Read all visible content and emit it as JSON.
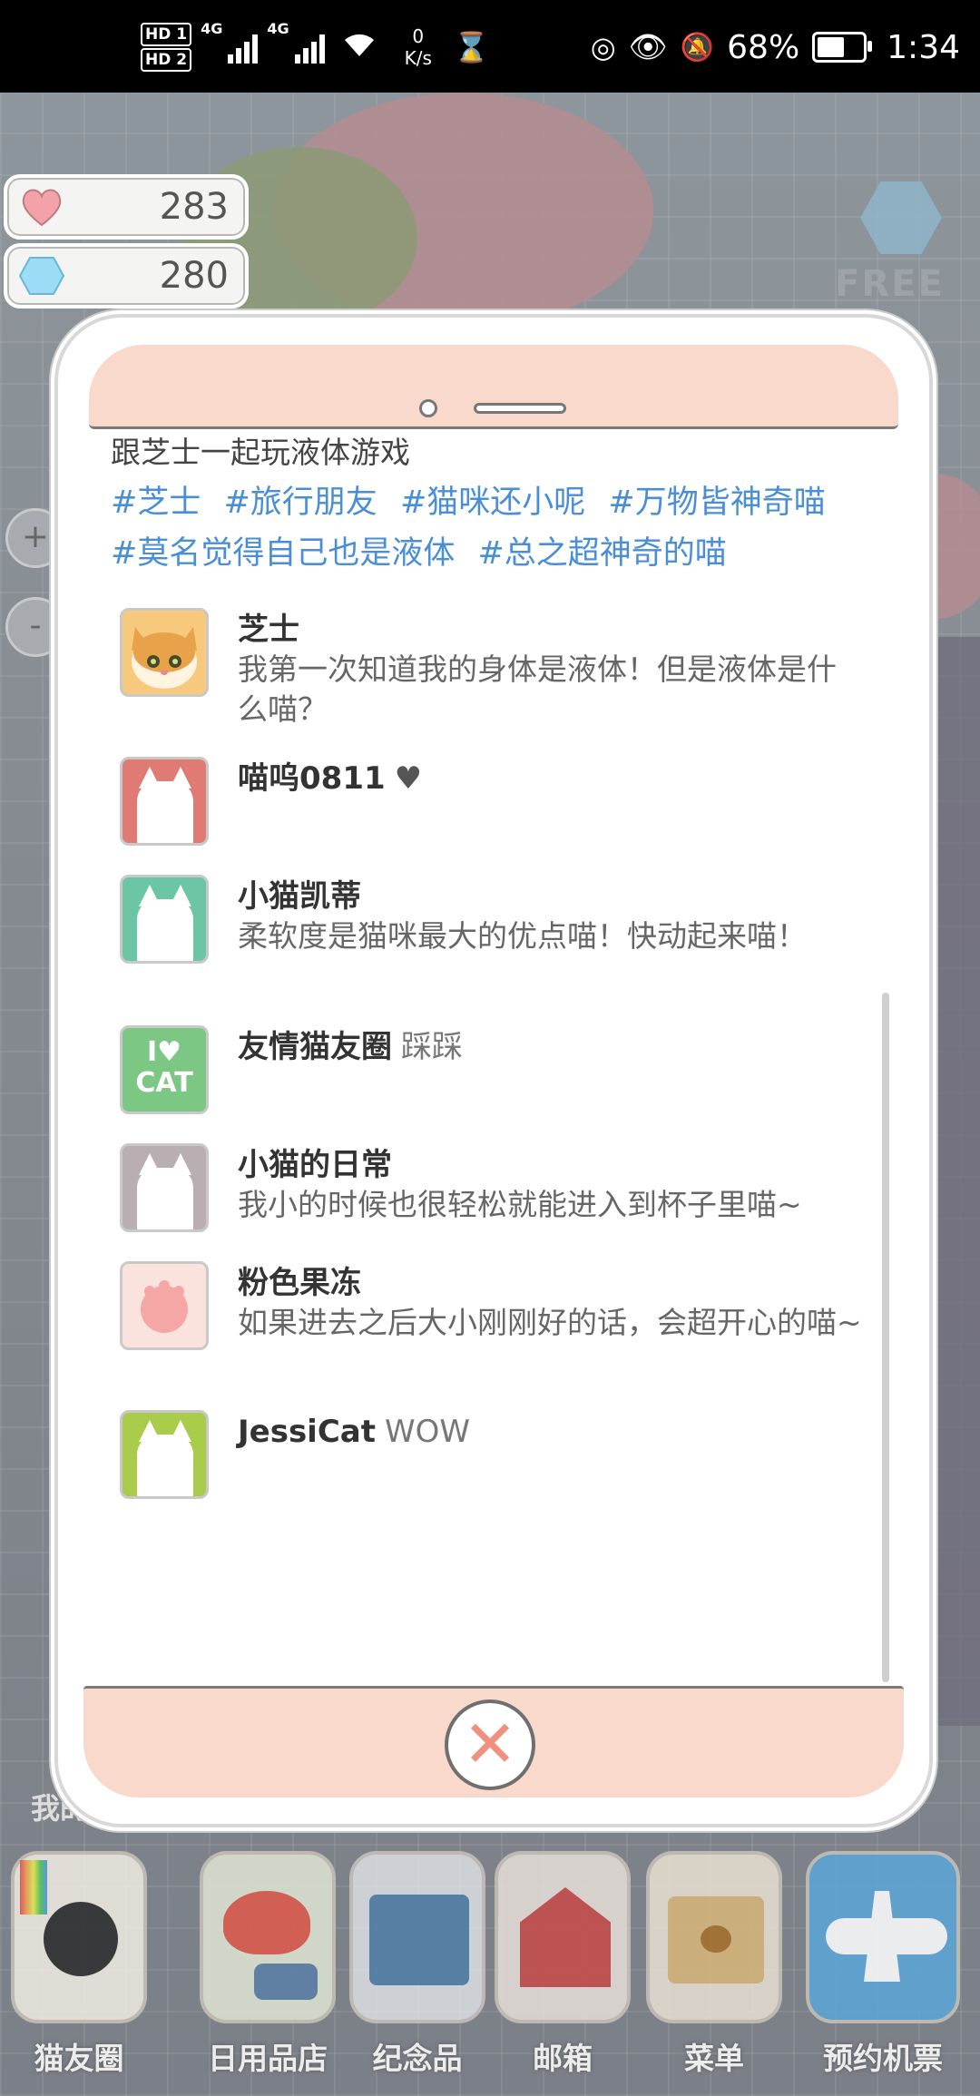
{
  "status_bar": {
    "hd1": "HD 1",
    "hd2": "HD 2",
    "net1": "4G",
    "net2": "4G",
    "speed_value": "0",
    "speed_unit": "K/s",
    "battery": "68%",
    "battery_level": 0.68,
    "time": "1:34"
  },
  "currency": {
    "hearts": "283",
    "gems": "280"
  },
  "free_badge": "FREE",
  "side_buttons": {
    "zoom_in": "+",
    "zoom_out": "-"
  },
  "post": {
    "text": "跟芝士一起玩液体游戏",
    "hashtags": [
      "#芝士",
      "#旅行朋友",
      "#猫咪还小呢",
      "#万物皆神奇喵",
      "#莫名觉得自己也是液体",
      "#总之超神奇的喵"
    ]
  },
  "comments": [
    {
      "name": "芝士",
      "extra": "",
      "text": "我第一次知道我的身体是液体！但是液体是什么喵？",
      "avatar_color": "#f6c97d"
    },
    {
      "name": "喵呜0811",
      "extra": "♥",
      "text": "",
      "avatar_color": "#e07b74"
    },
    {
      "name": "小猫凯蒂",
      "extra": "",
      "text": "柔软度是猫咪最大的优点喵！快动起来喵！",
      "avatar_color": "#6cc6a6"
    },
    {
      "name": "友情猫友圈",
      "extra": "踩踩",
      "text": "",
      "avatar_color": "#7cc784"
    },
    {
      "name": "小猫的日常",
      "extra": "",
      "text": "我小的时候也很轻松就能进入到杯子里喵~",
      "avatar_color": "#b9aeb2"
    },
    {
      "name": "粉色果冻",
      "extra": "",
      "text": "如果进去之后大小刚刚好的话，会超开心的喵~",
      "avatar_color": "#fbe3dd"
    },
    {
      "name": "JessiCat",
      "extra": "WOW",
      "text": "",
      "avatar_color": "#a9cc4a"
    }
  ],
  "avatar_badge": {
    "line1": "I",
    "line2": "CAT"
  },
  "close_button": "✕",
  "room_label": "我的房",
  "dock": [
    {
      "label": "猫友圈",
      "color": "#3b3b3b"
    },
    {
      "label": "日用品店",
      "color": "#c9d8a8"
    },
    {
      "label": "纪念品",
      "color": "#4f7fa8"
    },
    {
      "label": "邮箱",
      "color": "#c94a4a"
    },
    {
      "label": "菜单",
      "color": "#d8b77a"
    },
    {
      "label": "预约机票",
      "color": "#5aa6d8"
    }
  ]
}
